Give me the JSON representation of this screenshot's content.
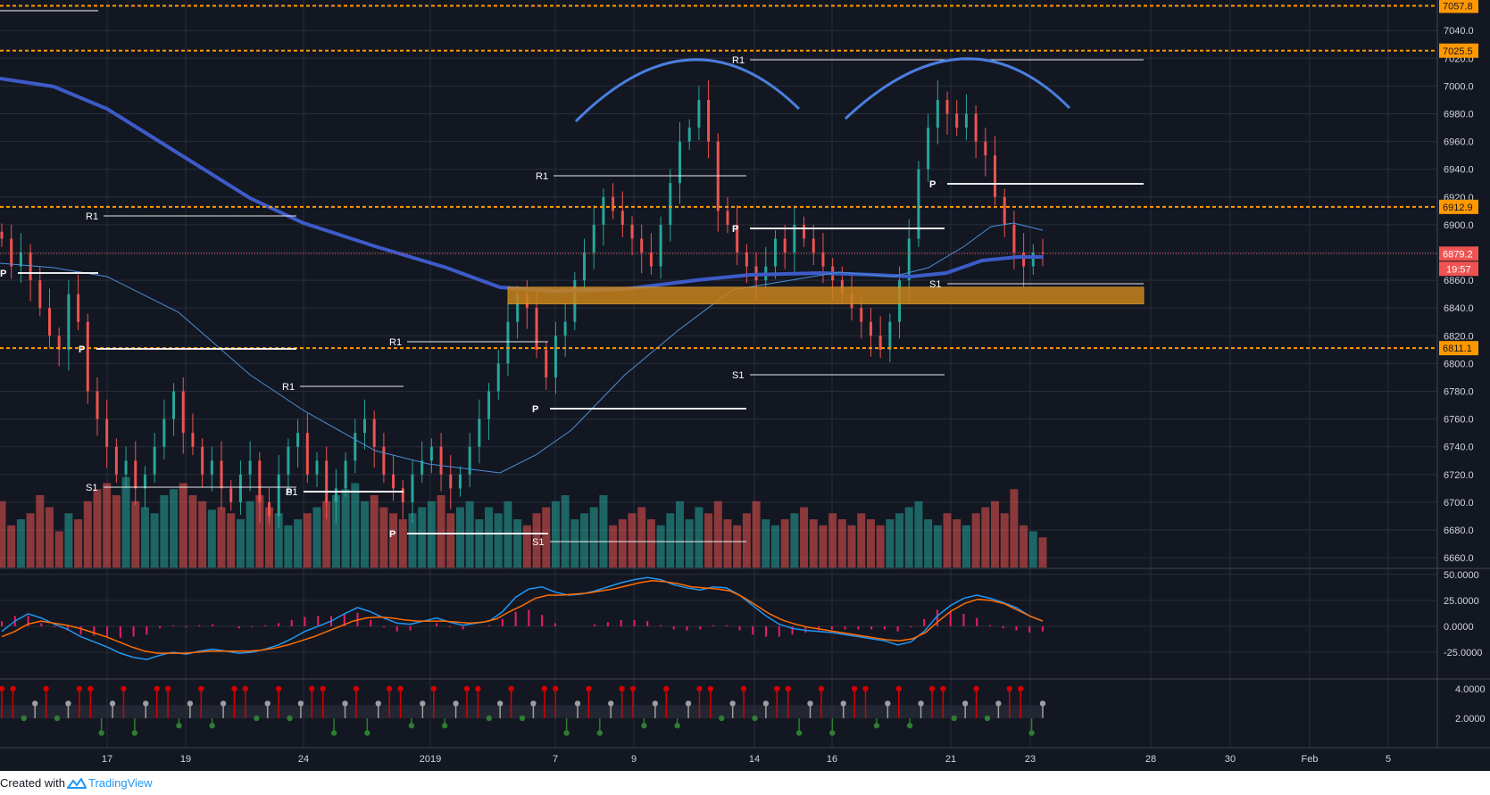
{
  "colors": {
    "background": "#131722",
    "grid": "#2a2e39",
    "up": "#26a69a",
    "down": "#ef5350",
    "ma_thick": "#3d5bc8",
    "ma_thin": "#4a90d9",
    "pivot_text": "#ffffff",
    "horizontal_level": "#ff9800",
    "zone": "#c8841c",
    "arc": "#4a7fe0",
    "macd_line": "#2196f3",
    "signal_line": "#ff6d00",
    "histogram": "#e91e63",
    "dot_red": "#d50000",
    "dot_green": "#2e7d32",
    "dot_gray": "#9e9e9e",
    "current_price_label": "#ef5350",
    "axis_text": "#d1d4dc",
    "brand": "#2196f3"
  },
  "chart_data": [
    {
      "type": "candlestick",
      "panel": "price",
      "x_ticks": [
        "17",
        "19",
        "24",
        "2019",
        "7",
        "9",
        "14",
        "16",
        "21",
        "23",
        "28",
        "30",
        "Feb",
        "5"
      ],
      "y_ticks": [
        6660.0,
        6680.0,
        6700.0,
        6720.0,
        6740.0,
        6760.0,
        6780.0,
        6800.0,
        6820.0,
        6840.0,
        6860.0,
        6880.0,
        6900.0,
        6920.0,
        6940.0,
        6960.0,
        6980.0,
        7000.0,
        7020.0,
        7040.0
      ],
      "ylim": [
        6653,
        7062
      ],
      "horizontal_levels": [
        7057.8,
        7025.5,
        6912.9,
        6811.1
      ],
      "current_price": 6879.2,
      "countdown": "19:57",
      "support_zone": [
        6843,
        6855
      ],
      "pivot_labels": [
        "R1",
        "P",
        "S1"
      ],
      "series_close": [
        6890,
        6870,
        6880,
        6860,
        6840,
        6820,
        6810,
        6850,
        6830,
        6780,
        6760,
        6740,
        6720,
        6730,
        6710,
        6720,
        6740,
        6760,
        6780,
        6750,
        6740,
        6720,
        6730,
        6710,
        6700,
        6720,
        6730,
        6700,
        6690,
        6720,
        6740,
        6750,
        6720,
        6730,
        6700,
        6710,
        6730,
        6750,
        6760,
        6740,
        6720,
        6710,
        6700,
        6720,
        6730,
        6740,
        6720,
        6710,
        6720,
        6740,
        6760,
        6780,
        6800,
        6830,
        6850,
        6840,
        6810,
        6790,
        6820,
        6830,
        6860,
        6880,
        6900,
        6920,
        6910,
        6900,
        6890,
        6880,
        6870,
        6900,
        6930,
        6960,
        6970,
        6990,
        6960,
        6910,
        6900,
        6880,
        6870,
        6860,
        6870,
        6890,
        6880,
        6900,
        6890,
        6880,
        6870,
        6860,
        6850,
        6840,
        6830,
        6820,
        6810,
        6830,
        6860,
        6890,
        6940,
        6970,
        6990,
        6980,
        6970,
        6980,
        6960,
        6950,
        6920,
        6900,
        6880,
        6870,
        6880,
        6879.2
      ],
      "volume_scale": [
        55,
        35,
        40,
        45,
        60,
        50,
        30,
        45,
        40,
        55,
        65,
        70,
        60,
        75,
        55,
        50,
        45,
        60,
        65,
        70,
        60,
        55,
        48,
        50,
        45,
        40,
        55,
        60,
        50,
        45,
        35,
        40,
        45,
        50,
        55,
        60,
        65,
        70,
        55,
        60,
        50,
        45,
        40,
        45,
        50,
        55,
        60,
        45,
        50,
        55,
        40,
        50,
        45,
        55,
        40,
        35,
        45,
        50,
        55,
        60,
        40,
        45,
        50,
        60,
        35,
        40,
        45,
        50,
        40,
        35,
        45,
        55,
        40,
        50,
        45,
        55,
        40,
        35,
        45,
        55,
        40,
        35,
        40,
        45,
        50,
        40,
        35,
        45,
        40,
        35,
        45,
        40,
        35,
        40,
        45,
        50,
        55,
        40,
        35,
        45,
        40,
        35,
        45,
        50,
        55,
        45,
        65,
        35,
        30,
        25,
        30
      ]
    },
    {
      "type": "line",
      "panel": "macd",
      "y_ticks": [
        50.0,
        25.0,
        0.0,
        -25.0
      ],
      "ylim": [
        -50,
        55
      ],
      "series": [
        {
          "values": [
            -5,
            5,
            12,
            8,
            2,
            -3,
            -10,
            -15,
            -20,
            -26,
            -30,
            -32,
            -28,
            -25,
            -27,
            -24,
            -22,
            -24,
            -26,
            -25,
            -22,
            -18,
            -12,
            -5,
            0,
            5,
            12,
            18,
            14,
            8,
            3,
            2,
            5,
            8,
            4,
            1,
            3,
            5,
            14,
            28,
            36,
            38,
            33,
            30,
            31,
            34,
            38,
            42,
            45,
            47,
            45,
            40,
            37,
            35,
            38,
            37,
            30,
            20,
            10,
            2,
            -2,
            -4,
            -5,
            -6,
            -8,
            -10,
            -12,
            -14,
            -18,
            -15,
            -5,
            10,
            20,
            27,
            30,
            27,
            23,
            18,
            10,
            5
          ]
        },
        {
          "values": [
            -10,
            -5,
            2,
            5,
            3,
            1,
            -2,
            -6,
            -10,
            -15,
            -20,
            -24,
            -26,
            -26,
            -26,
            -25,
            -24,
            -24,
            -24,
            -24,
            -23,
            -21,
            -18,
            -14,
            -10,
            -5,
            0,
            5,
            8,
            9,
            8,
            6,
            5,
            5,
            5,
            4,
            3,
            4,
            7,
            14,
            20,
            27,
            30,
            30,
            31,
            32,
            34,
            36,
            39,
            42,
            44,
            43,
            41,
            38,
            37,
            36,
            34,
            28,
            20,
            12,
            6,
            2,
            -1,
            -3,
            -5,
            -7,
            -9,
            -11,
            -13,
            -14,
            -12,
            -6,
            5,
            15,
            22,
            26,
            25,
            22,
            16,
            10,
            5
          ]
        },
        {
          "values": [
            5,
            10,
            10,
            3,
            -1,
            -4,
            -8,
            -9,
            -10,
            -11,
            -10,
            -8,
            -2,
            1,
            -1,
            1,
            2,
            0,
            -2,
            -1,
            1,
            3,
            6,
            9,
            10,
            10,
            12,
            13,
            6,
            -1,
            -5,
            -4,
            0,
            3,
            -1,
            -3,
            0,
            1,
            7,
            14,
            16,
            11,
            3,
            0,
            0,
            2,
            4,
            6,
            6,
            5,
            1,
            -3,
            -4,
            -3,
            1,
            1,
            -4,
            -8,
            -10,
            -10,
            -8,
            -6,
            -4,
            -3,
            -3,
            -3,
            -3,
            -3,
            -5,
            -1,
            7,
            16,
            15,
            12,
            8,
            1,
            -2,
            -4,
            -6,
            -5
          ]
        }
      ]
    },
    {
      "type": "scatter",
      "panel": "signals",
      "y_ticks": [
        4.0,
        2.0
      ],
      "ylim": [
        0,
        4.6
      ]
    }
  ],
  "footer": {
    "created_with": "Created with",
    "brand": "TradingView"
  }
}
